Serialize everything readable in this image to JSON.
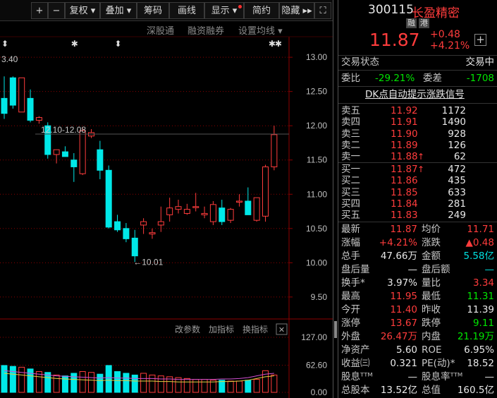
{
  "toolbar": {
    "items": [
      {
        "id": "plus",
        "label": "+"
      },
      {
        "id": "minus",
        "label": "−"
      },
      {
        "id": "fuquan",
        "label": "复权 ▾"
      },
      {
        "id": "diejia",
        "label": "叠加 ▾"
      },
      {
        "id": "chouma",
        "label": "筹码"
      },
      {
        "id": "huaxian",
        "label": "画线"
      },
      {
        "id": "xianshi",
        "label": "显示 ▾"
      },
      {
        "id": "jianyue",
        "label": "简约"
      },
      {
        "id": "yincang",
        "label": "隐藏 ▸▸"
      }
    ],
    "fullscreen_icon": "⛶"
  },
  "subbar": {
    "shengutong": "深股通",
    "rongzi": "融资融券",
    "shezhi": "设置均线 ▾"
  },
  "chart": {
    "top_left_label": "3.40",
    "range_label": "12.10-12.08",
    "low_label": "←10.01",
    "star_markers": [
      "✱",
      "✱",
      "✱"
    ],
    "arrow_markers": [
      "⬍",
      "⬍"
    ],
    "price_ticks": [
      "13.00",
      "12.50",
      "12.00",
      "11.50",
      "11.00",
      "10.50",
      "10.00",
      "9.50"
    ],
    "vol_toolbar": {
      "gaicanshu": "改参数",
      "jiazhibiao": "加指标",
      "huanzhibiao": "换指标",
      "close": "✕"
    },
    "vol_ticks": [
      "127.00",
      "62.60",
      "0.00"
    ]
  },
  "chart_data": {
    "type": "candlestick",
    "ohlc": [
      [
        12.4,
        12.72,
        12.1,
        12.18
      ],
      [
        12.7,
        12.72,
        12.25,
        12.3
      ],
      [
        12.2,
        12.7,
        12.2,
        12.7
      ],
      [
        12.4,
        12.53,
        12.05,
        12.08
      ],
      [
        12.08,
        12.14,
        12.03,
        12.12
      ],
      [
        12.0,
        12.05,
        11.52,
        11.58
      ],
      [
        11.58,
        11.65,
        11.45,
        11.65
      ],
      [
        11.62,
        11.7,
        11.55,
        11.55
      ],
      [
        11.5,
        11.6,
        11.18,
        11.4
      ],
      [
        11.3,
        11.98,
        11.28,
        11.93
      ],
      [
        11.85,
        11.95,
        11.82,
        11.9
      ],
      [
        11.65,
        11.78,
        11.22,
        11.35
      ],
      [
        11.35,
        11.42,
        10.5,
        10.52
      ],
      [
        10.6,
        10.7,
        10.45,
        10.48
      ],
      [
        10.5,
        10.58,
        10.3,
        10.35
      ],
      [
        10.36,
        10.48,
        10.01,
        10.1
      ],
      [
        10.55,
        10.65,
        10.42,
        10.6
      ],
      [
        10.42,
        10.5,
        10.35,
        10.44
      ],
      [
        10.55,
        10.82,
        10.45,
        10.6
      ],
      [
        10.7,
        10.95,
        10.6,
        10.8
      ],
      [
        10.78,
        10.92,
        10.72,
        10.82
      ],
      [
        10.72,
        10.86,
        10.7,
        10.78
      ],
      [
        10.82,
        11.02,
        10.75,
        10.82
      ],
      [
        10.7,
        10.82,
        10.65,
        10.72
      ],
      [
        10.6,
        10.9,
        10.55,
        10.85
      ],
      [
        10.8,
        10.92,
        10.55,
        10.6
      ],
      [
        10.62,
        10.8,
        10.58,
        10.78
      ],
      [
        10.9,
        11.0,
        10.82,
        10.9
      ],
      [
        10.9,
        11.1,
        10.7,
        10.7
      ],
      [
        10.62,
        10.95,
        10.6,
        10.95
      ],
      [
        10.68,
        11.43,
        10.6,
        11.4
      ],
      [
        11.4,
        12.0,
        11.35,
        11.87
      ]
    ],
    "volume": [
      62,
      60,
      58,
      54,
      48,
      46,
      40,
      38,
      44,
      48,
      46,
      42,
      62,
      48,
      44,
      40,
      44,
      40,
      38,
      36,
      34,
      32,
      30,
      30,
      28,
      28,
      26,
      26,
      28,
      30,
      50,
      40
    ],
    "ma_line": [
      30,
      28,
      26,
      24,
      22,
      20,
      18,
      17,
      16,
      15,
      14,
      13,
      14,
      13,
      13,
      12,
      12,
      12,
      11,
      11,
      10,
      10,
      10,
      10,
      10,
      11,
      11,
      12,
      14,
      18,
      22,
      24
    ],
    "price_axis": [
      9.2,
      13.3
    ],
    "volume_axis": [
      0,
      127
    ]
  },
  "quote": {
    "code": "300115",
    "name": "长盈精密",
    "tag_rong": "融",
    "tag_gang": "港",
    "price": "11.87",
    "change": "+0.48",
    "change_pct": "+4.21%",
    "add_icon": "+",
    "status_label": "交易状态",
    "status_value": "交易中",
    "weibi_label": "委比",
    "weibi_value": "-29.21%",
    "weicha_label": "委差",
    "weicha_value": "-1708",
    "signal_link": "DK点自动提示涨跌信号",
    "asks": [
      {
        "label": "卖五",
        "price": "11.92",
        "vol": "1172",
        "mark": ""
      },
      {
        "label": "卖四",
        "price": "11.91",
        "vol": "1490",
        "mark": ""
      },
      {
        "label": "卖三",
        "price": "11.90",
        "vol": "928",
        "mark": ""
      },
      {
        "label": "卖二",
        "price": "11.89",
        "vol": "126",
        "mark": ""
      },
      {
        "label": "卖一",
        "price": "11.88",
        "vol": "62",
        "mark": "↑"
      }
    ],
    "bids": [
      {
        "label": "买一",
        "price": "11.87",
        "vol": "472",
        "mark": "↑"
      },
      {
        "label": "买二",
        "price": "11.86",
        "vol": "435",
        "mark": ""
      },
      {
        "label": "买三",
        "price": "11.85",
        "vol": "633",
        "mark": ""
      },
      {
        "label": "买四",
        "price": "11.84",
        "vol": "281",
        "mark": ""
      },
      {
        "label": "买五",
        "price": "11.83",
        "vol": "249",
        "mark": ""
      }
    ],
    "stats": [
      {
        "l1": "最新",
        "v1": "11.87",
        "c1": "red",
        "l2": "均价",
        "v2": "11.71",
        "c2": "red"
      },
      {
        "l1": "涨幅",
        "v1": "+4.21%",
        "c1": "red",
        "l2": "涨跌",
        "v2": "▲0.48",
        "c2": "red"
      },
      {
        "l1": "总手",
        "v1": "47.66万",
        "c1": "white",
        "l2": "金额",
        "v2": "5.58亿",
        "c2": "cyan"
      },
      {
        "l1": "盘后量",
        "v1": "—",
        "c1": "white",
        "l2": "盘后额",
        "v2": "—",
        "c2": "cyan"
      },
      {
        "l1": "换手*",
        "v1": "3.97%",
        "c1": "white",
        "l2": "量比",
        "v2": "3.34",
        "c2": "red"
      },
      {
        "l1": "最高",
        "v1": "11.95",
        "c1": "red",
        "l2": "最低",
        "v2": "11.31",
        "c2": "green"
      },
      {
        "l1": "今开",
        "v1": "11.40",
        "c1": "red",
        "l2": "昨收",
        "v2": "11.39",
        "c2": "white"
      },
      {
        "l1": "涨停",
        "v1": "13.67",
        "c1": "red",
        "l2": "跌停",
        "v2": "9.11",
        "c2": "green"
      },
      {
        "l1": "外盘",
        "v1": "26.47万",
        "c1": "red",
        "l2": "内盘",
        "v2": "21.19万",
        "c2": "green"
      },
      {
        "l1": "净资产",
        "v1": "5.60",
        "c1": "white",
        "l2": "ROE",
        "v2": "6.95%",
        "c2": "white"
      },
      {
        "l1": "收益㈢",
        "v1": "0.321",
        "c1": "white",
        "l2": "PE(动)*",
        "v2": "18.52",
        "c2": "white"
      },
      {
        "l1": "股息ᵀᵀᴹ",
        "v1": "—",
        "c1": "white",
        "l2": "股息率ᵀᵀᴹ",
        "v2": "—",
        "c2": "white"
      },
      {
        "l1": "总股本",
        "v1": "13.52亿",
        "c1": "white",
        "l2": "总值",
        "v2": "160.5亿",
        "c2": "white"
      }
    ]
  },
  "colors": {
    "up": "#ff3c3c",
    "down": "#00e8e8",
    "ma": "#e0d040",
    "ma2": "#d050d0",
    "grid": "#8b0000"
  }
}
